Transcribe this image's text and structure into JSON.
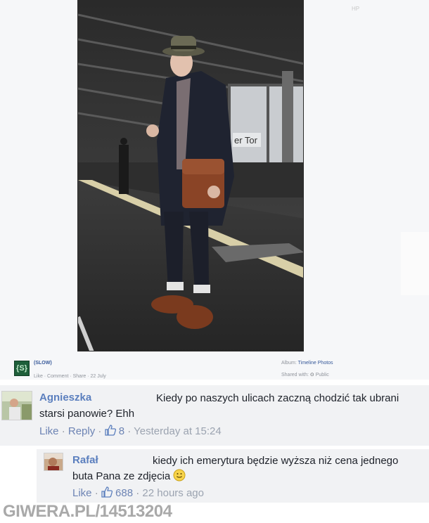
{
  "post": {
    "corner_mark": "HP",
    "page_name": "(SLOW)",
    "page_logo_text": "{S}",
    "actions": "Like · Comment · Share · 22 July",
    "album_label": "Album:",
    "album_name": "Timeline Photos",
    "shared_label": "Shared with:",
    "shared_value": "Public",
    "photo_sign_text": "er Tor"
  },
  "comments": [
    {
      "author": "Agnieszka",
      "text": "Kiedy po naszych ulicach zaczną chodzić tak ubrani",
      "text_line2": "starsi panowie? Ehh",
      "like_label": "Like",
      "reply_label": "Reply",
      "like_count": "8",
      "time": "Yesterday at 15:24"
    },
    {
      "author": "Rafał",
      "text": "kiedy ich emerytura będzie wyższa niż cena jednego",
      "text_line2": "buta Pana ze zdjęcia",
      "like_label": "Like",
      "like_count": "688",
      "time": "22 hours ago"
    }
  ],
  "watermark": "GIWERA.PL/14513204",
  "colors": {
    "link": "#365899",
    "comment_bg": "#f1f2f4",
    "author": "#5b7fbe"
  }
}
